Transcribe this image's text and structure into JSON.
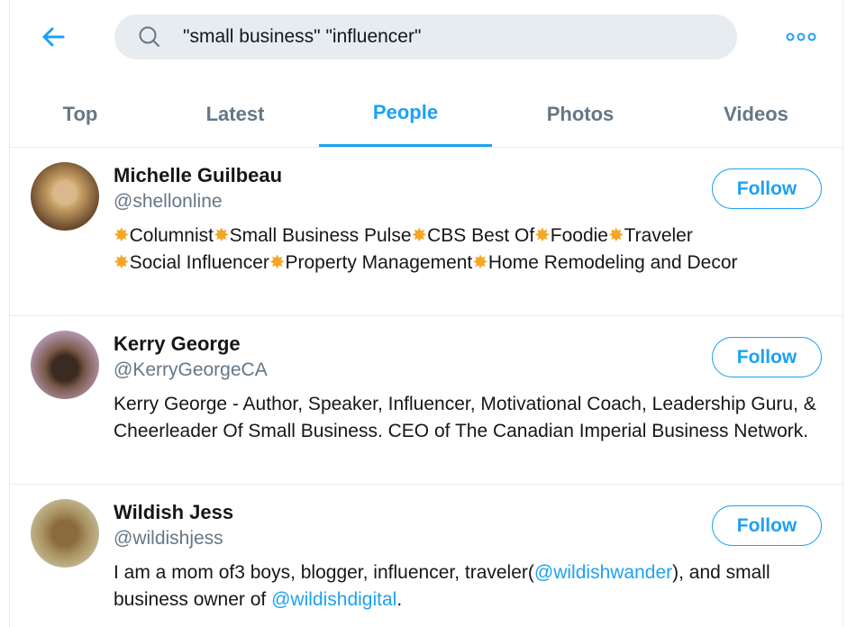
{
  "search": {
    "query": "\"small business\" \"influencer\""
  },
  "colors": {
    "accent": "#1da1f2",
    "muted": "#657786",
    "search_bg": "#e6ecf0"
  },
  "tabs": [
    {
      "label": "Top"
    },
    {
      "label": "Latest"
    },
    {
      "label": "People",
      "active": true
    },
    {
      "label": "Photos"
    },
    {
      "label": "Videos"
    }
  ],
  "people": [
    {
      "name": "Michelle Guilbeau",
      "handle": "@shellonline",
      "follow_label": "Follow",
      "bio_parts": [
        "Columnist",
        "Small Business Pulse",
        "CBS Best Of",
        "Foodie",
        "Traveler",
        "Social Influencer",
        "Property Management",
        "Home Remodeling and Decor"
      ]
    },
    {
      "name": "Kerry George",
      "handle": "@KerryGeorgeCA",
      "follow_label": "Follow",
      "bio": "Kerry George - Author, Speaker, Influencer, Motivational Coach, Leadership Guru, & Cheerleader Of Small Business. CEO of The Canadian Imperial Business Network."
    },
    {
      "name": "Wildish Jess",
      "handle": "@wildishjess",
      "follow_label": "Follow",
      "bio_a": "I am a mom of3 boys, blogger, influencer, traveler(",
      "link1": "@wildishwander",
      "bio_b": "), and small business owner of ",
      "link2": "@wildishdigital",
      "bio_c": "."
    }
  ]
}
